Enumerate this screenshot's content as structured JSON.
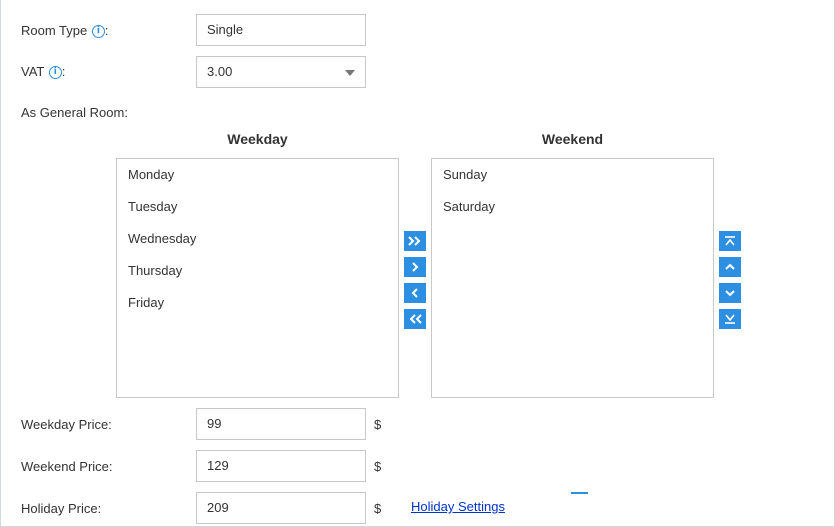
{
  "room_type": {
    "label": "Room Type",
    "suffix": ":",
    "value": "Single"
  },
  "vat": {
    "label": "VAT",
    "suffix": ":",
    "value": "3.00"
  },
  "general_room": {
    "label": "As General Room:"
  },
  "weekday": {
    "heading": "Weekday",
    "items": [
      "Monday",
      "Tuesday",
      "Wednesday",
      "Thursday",
      "Friday"
    ]
  },
  "weekend": {
    "heading": "Weekend",
    "items": [
      "Sunday",
      "Saturday"
    ]
  },
  "transfer_buttons": [
    "move-all-right-icon",
    "move-right-icon",
    "move-left-icon",
    "move-all-left-icon"
  ],
  "order_buttons": [
    "move-top-icon",
    "move-up-icon",
    "move-down-icon",
    "move-bottom-icon"
  ],
  "prices": {
    "weekday": {
      "label": "Weekday Price:",
      "value": "99",
      "unit": "$"
    },
    "weekend": {
      "label": "Weekend Price:",
      "value": "129",
      "unit": "$"
    },
    "holiday": {
      "label": "Holiday Price:",
      "value": "209",
      "unit": "$"
    }
  },
  "holiday_settings": {
    "label": "Holiday Settings"
  },
  "colors": {
    "accent": "#2d8fe1",
    "info": "#2a8ee0",
    "link": "#0033cc",
    "border": "#c8c8c8"
  }
}
